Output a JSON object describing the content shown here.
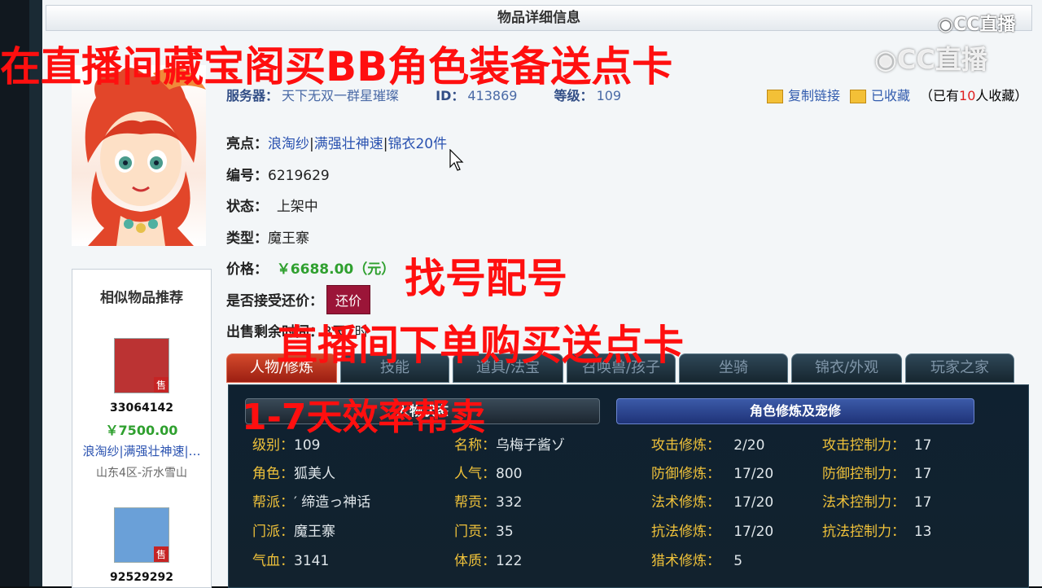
{
  "header": {
    "title": "物品详细信息"
  },
  "info": {
    "server_label": "服务器：",
    "server": "天下无双一群星璀璨",
    "id_label": "ID：",
    "id": "413869",
    "level_label": "等级：",
    "level": "109"
  },
  "actions": {
    "copy_link": "复制链接",
    "favorited": "已收藏",
    "fav_prefix": "（已有",
    "fav_count": "10",
    "fav_suffix": "人收藏）"
  },
  "fields": {
    "highlight_label": "亮点：",
    "highlight_1": "浪淘纱",
    "sep1": "|",
    "highlight_2": "满强壮神速",
    "sep2": "|",
    "highlight_3": "锦衣20件",
    "number_label": "编号：",
    "number": "6219629",
    "status_label": "状态：",
    "status": "上架中",
    "type_label": "类型：",
    "type": "魔王寨",
    "price_label": "价格：",
    "price": "￥6688.00（元）",
    "bargain_label": "是否接受还价：",
    "bargain_button": "还价",
    "remaining_label": "出售剩余时间：",
    "remaining": "3天1时"
  },
  "similar": {
    "title": "相似物品推荐",
    "sell_tag": "售",
    "items": [
      {
        "id": "33064142",
        "price": "￥7500.00",
        "tags": "浪淘纱|满强壮神速|…",
        "server": "山东4区-沂水雪山"
      },
      {
        "id": "92529292"
      }
    ]
  },
  "tabs": [
    "人物/修炼",
    "技能",
    "道具/法宝",
    "召唤兽/孩子",
    "坐骑",
    "锦衣/外观",
    "玩家之家"
  ],
  "subtabs": {
    "left": "人物状态",
    "right": "角色修炼及宠修"
  },
  "stats": {
    "col1": [
      {
        "k": "级别：",
        "v": "109"
      },
      {
        "k": "角色：",
        "v": "狐美人"
      },
      {
        "k": "帮派：",
        "v": "′ 缔造っ神话"
      },
      {
        "k": "门派：",
        "v": "魔王寨"
      },
      {
        "k": "气血：",
        "v": "3141"
      }
    ],
    "col2": [
      {
        "k": "名称：",
        "v": "乌梅子酱ゾ"
      },
      {
        "k": "人气：",
        "v": "800"
      },
      {
        "k": "帮贡：",
        "v": "332"
      },
      {
        "k": "门贡：",
        "v": "35"
      },
      {
        "k": "体质：",
        "v": "122"
      }
    ],
    "col3": [
      {
        "k": "攻击修炼：",
        "v": "2/20"
      },
      {
        "k": "防御修炼：",
        "v": "17/20"
      },
      {
        "k": "法术修炼：",
        "v": "17/20"
      },
      {
        "k": "抗法修炼：",
        "v": "17/20"
      },
      {
        "k": "猎术修炼：",
        "v": "5"
      }
    ],
    "col4": [
      {
        "k": "攻击控制力：",
        "v": "17"
      },
      {
        "k": "防御控制力：",
        "v": "17"
      },
      {
        "k": "法术控制力：",
        "v": "17"
      },
      {
        "k": "抗法控制力：",
        "v": "13"
      }
    ]
  },
  "overlays": {
    "line1": "在直播间藏宝阁买BB角色装备送点卡",
    "line2": "找号配号",
    "line3": "直播间下单购买送点卡",
    "line4": "1-7天效率帮卖"
  },
  "watermark": {
    "small": "CC直播",
    "large": "CC直播"
  },
  "colors": {
    "accent_red": "#ff0f0f",
    "price_green": "#2fa02f",
    "tab_active": "#c0361f",
    "stat_key": "#f0c23a"
  }
}
